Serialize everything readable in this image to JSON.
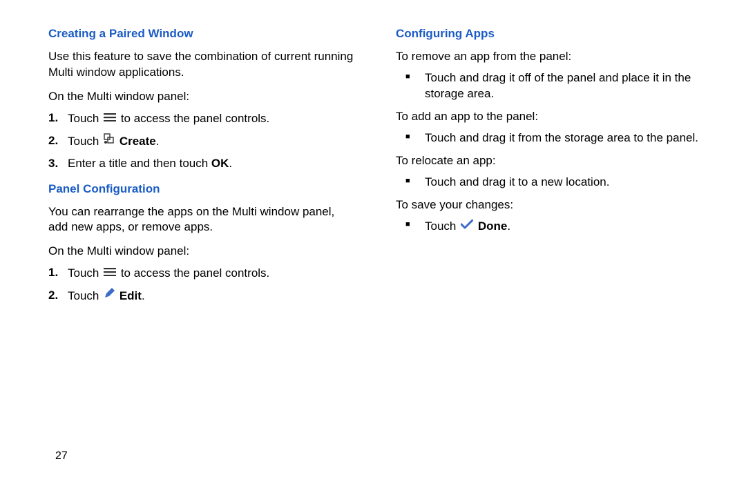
{
  "pageNumber": "27",
  "left": {
    "section1": {
      "heading": "Creating a Paired Window",
      "intro": "Use this feature to save the combination of current running Multi window applications.",
      "lead": "On the Multi window panel:",
      "steps": [
        {
          "num": "1.",
          "prefix": "Touch ",
          "icon": "menu",
          "suffix": " to access the panel controls."
        },
        {
          "num": "2.",
          "prefix": "Touch ",
          "icon": "create",
          "suffix": "",
          "bold": "Create",
          "after": "."
        },
        {
          "num": "3.",
          "prefix": "Enter a title and then touch ",
          "bold": "OK",
          "after": "."
        }
      ]
    },
    "section2": {
      "heading": "Panel Configuration",
      "intro": "You can rearrange the apps on the Multi window panel, add new apps, or remove apps.",
      "lead": "On the Multi window panel:",
      "steps": [
        {
          "num": "1.",
          "prefix": "Touch ",
          "icon": "menu",
          "suffix": " to access the panel controls."
        },
        {
          "num": "2.",
          "prefix": "Touch ",
          "icon": "edit",
          "suffix": "",
          "bold": "Edit",
          "after": "."
        }
      ]
    }
  },
  "right": {
    "section1": {
      "heading": "Configuring Apps",
      "blocks": [
        {
          "lead": "To remove an app from the panel:",
          "bullets": [
            {
              "text": "Touch and drag it off of the panel and place it in the storage area."
            }
          ]
        },
        {
          "lead": "To add an app to the panel:",
          "bullets": [
            {
              "text": "Touch and drag it from the storage area to the panel."
            }
          ]
        },
        {
          "lead": "To relocate an app:",
          "bullets": [
            {
              "text": "Touch and drag it to a new location."
            }
          ]
        },
        {
          "lead": "To save your changes:",
          "bullets": [
            {
              "prefix": "Touch ",
              "icon": "done",
              "bold": "Done",
              "after": "."
            }
          ]
        }
      ]
    }
  }
}
